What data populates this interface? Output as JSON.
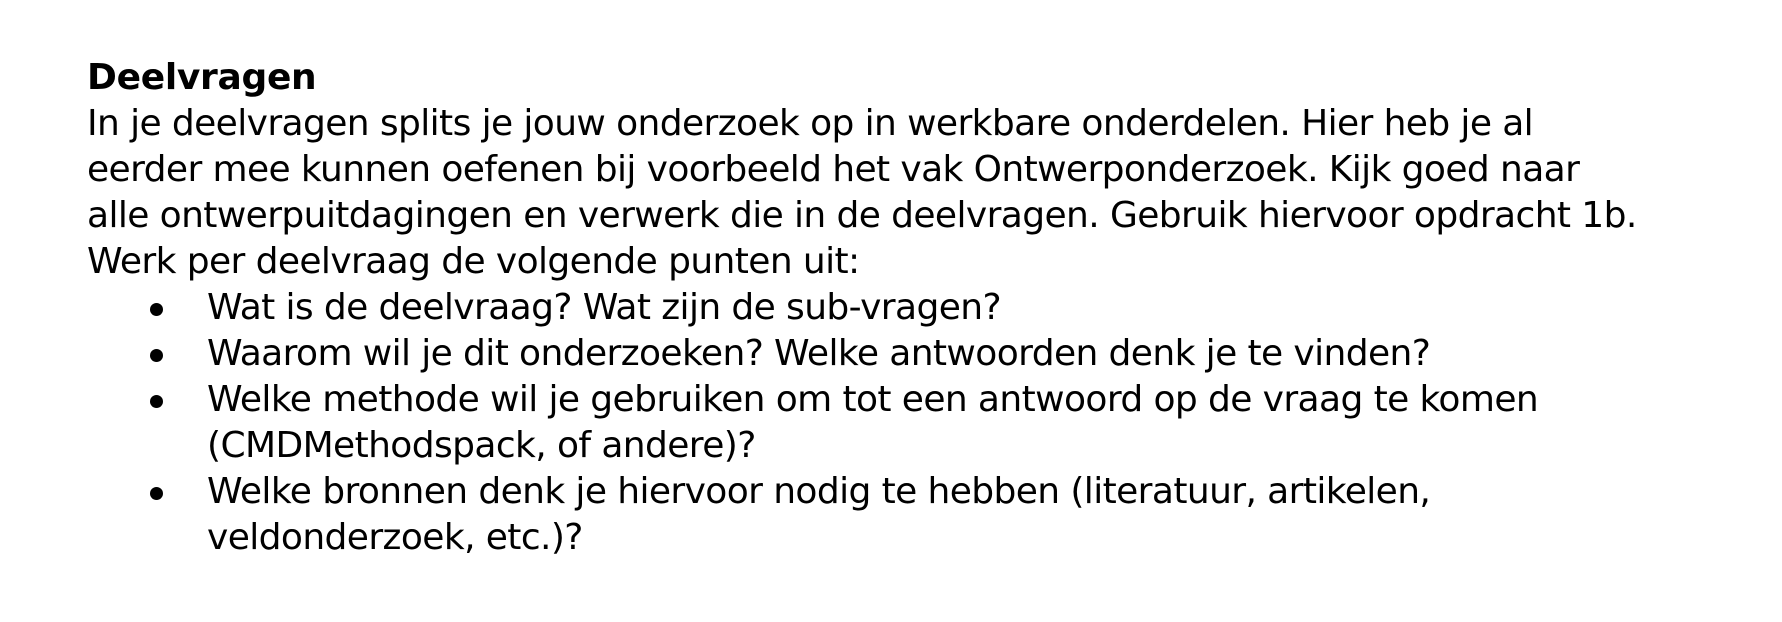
{
  "document": {
    "heading": "Deelvragen",
    "paragraph_lines": [
      "In je deelvragen splits je jouw onderzoek op in werkbare onderdelen. Hier heb je al",
      "eerder mee kunnen oefenen bij voorbeeld het vak Ontwerponderzoek. Kijk goed naar",
      "alle ontwerpuitdagingen en verwerk die in de deelvragen. Gebruik hiervoor opdracht 1b.",
      "Werk per deelvraag de volgende punten uit:"
    ],
    "bullets": [
      {
        "lines": [
          "Wat is de deelvraag? Wat zijn de sub-vragen?"
        ]
      },
      {
        "lines": [
          "Waarom wil je dit onderzoeken? Welke antwoorden denk je te vinden?"
        ]
      },
      {
        "lines": [
          "Welke methode wil je gebruiken om tot een antwoord op de vraag te komen",
          "(CMDMethodspack, of andere)?"
        ]
      },
      {
        "lines": [
          "Welke bronnen denk je hiervoor nodig te hebben (literatuur, artikelen,",
          "veldonderzoek, etc.)?"
        ]
      }
    ]
  }
}
